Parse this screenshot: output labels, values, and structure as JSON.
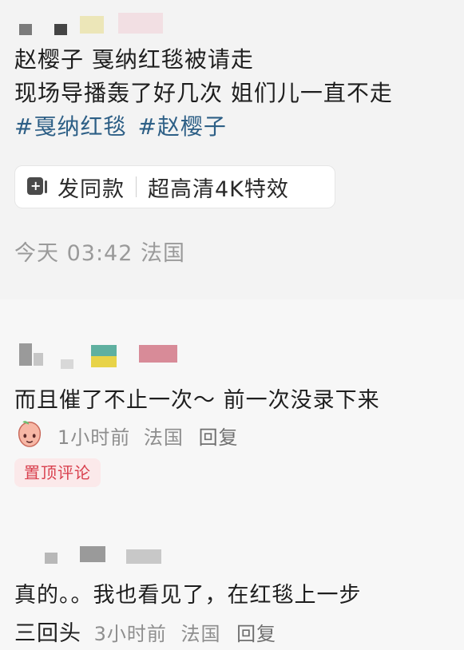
{
  "post": {
    "line1": "赵樱子 戛纳红毯被请走",
    "line2": "现场导播轰了好几次 姐们儿一直不走",
    "hashtags": [
      "#戛纳红毯",
      "#赵樱子"
    ],
    "sticker_label": "发同款",
    "effect_label": "超高清4K特效",
    "meta": "今天 03:42 法国",
    "sticker_icon": "sticker-plus-icon"
  },
  "comments": [
    {
      "text": "而且催了不止一次～ 前一次没录下来",
      "meta_time": "1小时前",
      "meta_location": "法国",
      "reply_label": "回复",
      "avatar_icon": "peach-face-icon",
      "pinned_label": "置顶评论",
      "pinned_bg": "#fbe9ea",
      "pinned_color": "#d9414f"
    },
    {
      "text_line1": "真的。。我也看见了，在红毯上一步",
      "text_line2": "三回头",
      "meta_time": "3小时前",
      "meta_location": "法国",
      "reply_label": "回复"
    }
  ],
  "colors": {
    "hashtag": "#2d5f86",
    "meta": "#9a9a9a"
  }
}
